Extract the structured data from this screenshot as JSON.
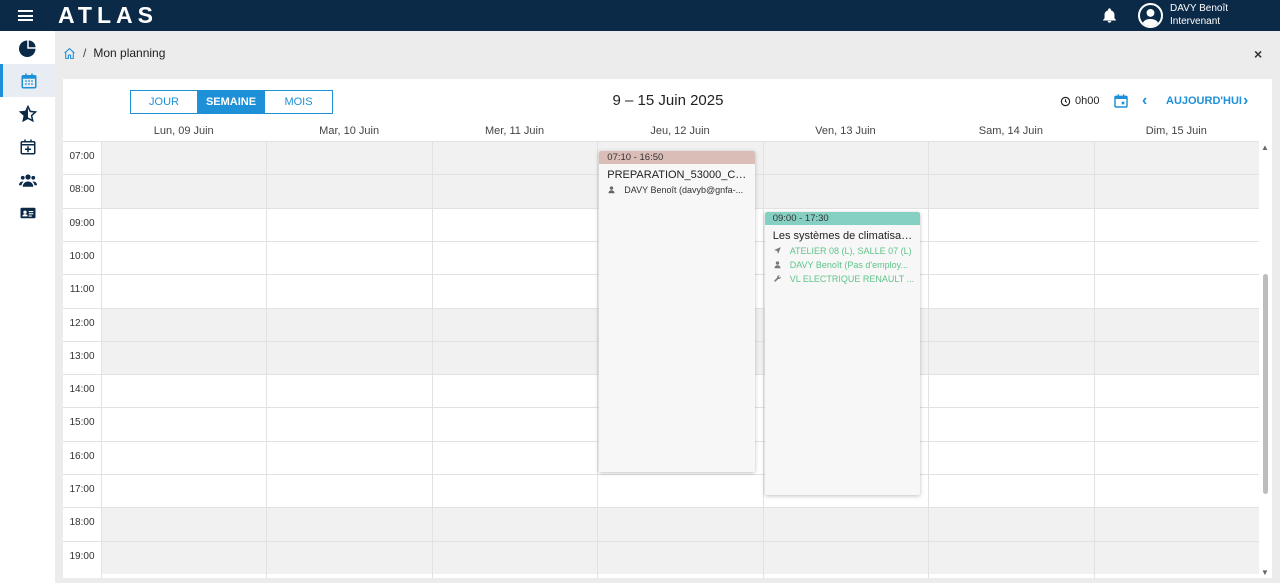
{
  "header": {
    "logo": "ATLAS",
    "user_name": "DAVY Benoît",
    "user_role": "Intervenant"
  },
  "sidebar": {
    "items": [
      {
        "icon": "pie-chart-icon"
      },
      {
        "icon": "calendar-icon",
        "active": true
      },
      {
        "icon": "star-icon"
      },
      {
        "icon": "calendar-plus-icon"
      },
      {
        "icon": "users-icon"
      },
      {
        "icon": "id-card-icon"
      }
    ]
  },
  "breadcrumb": {
    "separator": "/",
    "current": "Mon planning"
  },
  "close": "×",
  "calendar": {
    "views": [
      "JOUR",
      "SEMAINE",
      "MOIS"
    ],
    "active_view": "SEMAINE",
    "title": "9 – 15 Juin 2025",
    "total_hours": "0h00",
    "today_label": "AUJOURD'HUI",
    "prev": "‹",
    "next": "›",
    "days": [
      "Lun, 09 Juin",
      "Mar, 10 Juin",
      "Mer, 11 Juin",
      "Jeu, 12 Juin",
      "Ven, 13 Juin",
      "Sam, 14 Juin",
      "Dim, 15 Juin"
    ],
    "hours": [
      "07:00",
      "08:00",
      "09:00",
      "10:00",
      "11:00",
      "12:00",
      "13:00",
      "14:00",
      "15:00",
      "16:00",
      "17:00",
      "18:00",
      "19:00"
    ],
    "events": [
      {
        "day": 3,
        "time": "07:10 - 16:50",
        "title": "PREPARATION_53000_CQF...",
        "color": "#dbbdb8",
        "lines": [
          {
            "icon": "user-icon",
            "text": "DAVY Benoît (davyb@gnfa-...",
            "color": "#333333"
          }
        ]
      },
      {
        "day": 4,
        "time": "09:00 - 17:30",
        "title": "Les systèmes de climatisat...",
        "color": "#86cfc3",
        "lines": [
          {
            "icon": "location-arrow-icon",
            "text": "ATELIER 08 (L), SALLE 07 (L)",
            "color": "#5fc48a"
          },
          {
            "icon": "user-icon",
            "text": "DAVY Benoît (Pas d'employ...",
            "color": "#5fc48a"
          },
          {
            "icon": "wrench-icon",
            "text": "VL ELECTRIQUE RENAULT ...",
            "color": "#5fc48a"
          }
        ]
      }
    ]
  },
  "colors": {
    "topbar": "#0b2a47",
    "accent": "#1e90d8"
  }
}
